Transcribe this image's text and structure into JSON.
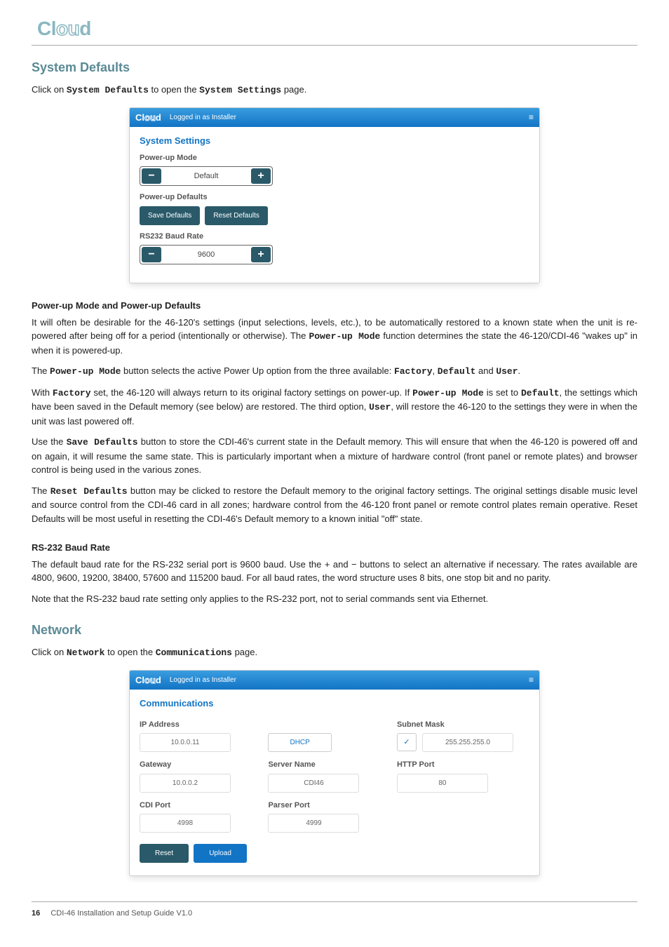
{
  "logo_text": "Cloud",
  "section1_title": "System Defaults",
  "section1_intro_a": "Click on ",
  "section1_intro_b": "System Defaults",
  "section1_intro_c": " to open the ",
  "section1_intro_d": "System Settings",
  "section1_intro_e": " page.",
  "panel1": {
    "logo": "Cloud",
    "login": "Logged in as Installer",
    "hamburger": "≡",
    "title": "System Settings",
    "power_up_mode_label": "Power-up Mode",
    "power_up_mode_value": "Default",
    "minus": "−",
    "plus": "+",
    "power_up_defaults_label": "Power-up Defaults",
    "save_defaults": "Save Defaults",
    "reset_defaults": "Reset Defaults",
    "baud_label": "RS232 Baud Rate",
    "baud_value": "9600"
  },
  "sub1_title": "Power-up Mode and Power-up Defaults",
  "p1a": "It will often be desirable for the 46-120's settings (input selections, levels, etc.), to be automatically restored to a known state when the unit is re-powered after being off for a period (intentionally or otherwise). The ",
  "p1b": "Power-up Mode",
  "p1c": " function determines the state the 46-120/CDI-46 \"wakes up\" in when it is powered-up.",
  "p2a": " The ",
  "p2b": "Power-up Mode",
  "p2c": " button selects the active Power Up option from the three available: ",
  "p2d": "Factory",
  "p2e": ", ",
  "p2f": "Default",
  "p2g": " and ",
  "p2h": "User",
  "p2i": ".",
  "p3a": " With ",
  "p3b": "Factory",
  "p3c": " set, the 46-120 will always return to its original factory settings on power-up. If ",
  "p3d": "Power-up Mode",
  "p3e": " is set to ",
  "p3f": "Default",
  "p3g": ", the settings which have been saved in the Default memory (see below) are restored. The third option, ",
  "p3h": "User",
  "p3i": ", will restore the 46-120 to the settings they were in when the unit was last powered off.",
  "p4a": "Use the ",
  "p4b": "Save Defaults",
  "p4c": " button to store the CDI-46's current state in the Default memory. This will ensure that when the 46-120 is powered off and on again, it will resume the same state. This is particularly important when a mixture of hardware control (front panel or remote plates) and browser control is being used in the various zones.",
  "p5a": "The ",
  "p5b": "Reset Defaults",
  "p5c": " button may be clicked to restore the Default memory to the original factory settings. The original settings disable music level and source control from the CDI-46 card in all zones; hardware control from the 46-120 front panel or remote control plates remain operative. Reset Defaults will be most useful in resetting the CDI-46's Default memory to a known initial \"off\" state.",
  "sub2_title": "RS-232 Baud Rate",
  "p6": "The default baud rate for the RS-232 serial port is 9600 baud. Use the + and − buttons to select an alternative if necessary. The rates available are 4800, 9600, 19200, 38400, 57600 and 115200 baud. For all baud rates, the word structure uses 8 bits, one stop bit and no parity.",
  "p7": "Note that the RS-232 baud rate setting only applies to the RS-232 port, not to serial commands sent via Ethernet.",
  "section2_title": "Network",
  "section2_intro_a": "Click on ",
  "section2_intro_b": "Network",
  "section2_intro_c": " to open the ",
  "section2_intro_d": "Communications",
  "section2_intro_e": " page.",
  "panel2": {
    "logo": "Cloud",
    "login": "Logged in as Installer",
    "hamburger": "≡",
    "title": "Communications",
    "ip_label": "IP Address",
    "ip_value": "10.0.0.11",
    "dhcp": "DHCP",
    "check": "✓",
    "subnet_label": "Subnet Mask",
    "subnet_value": "255.255.255.0",
    "gateway_label": "Gateway",
    "gateway_value": "10.0.0.2",
    "server_name_label": "Server Name",
    "server_name_value": "CDI46",
    "http_port_label": "HTTP Port",
    "http_port_value": "80",
    "cdi_port_label": "CDI Port",
    "cdi_port_value": "4998",
    "parser_port_label": "Parser Port",
    "parser_port_value": "4999",
    "reset": "Reset",
    "upload": "Upload"
  },
  "footer_page": "16",
  "footer_text": "CDI-46 Installation and Setup Guide V1.0"
}
